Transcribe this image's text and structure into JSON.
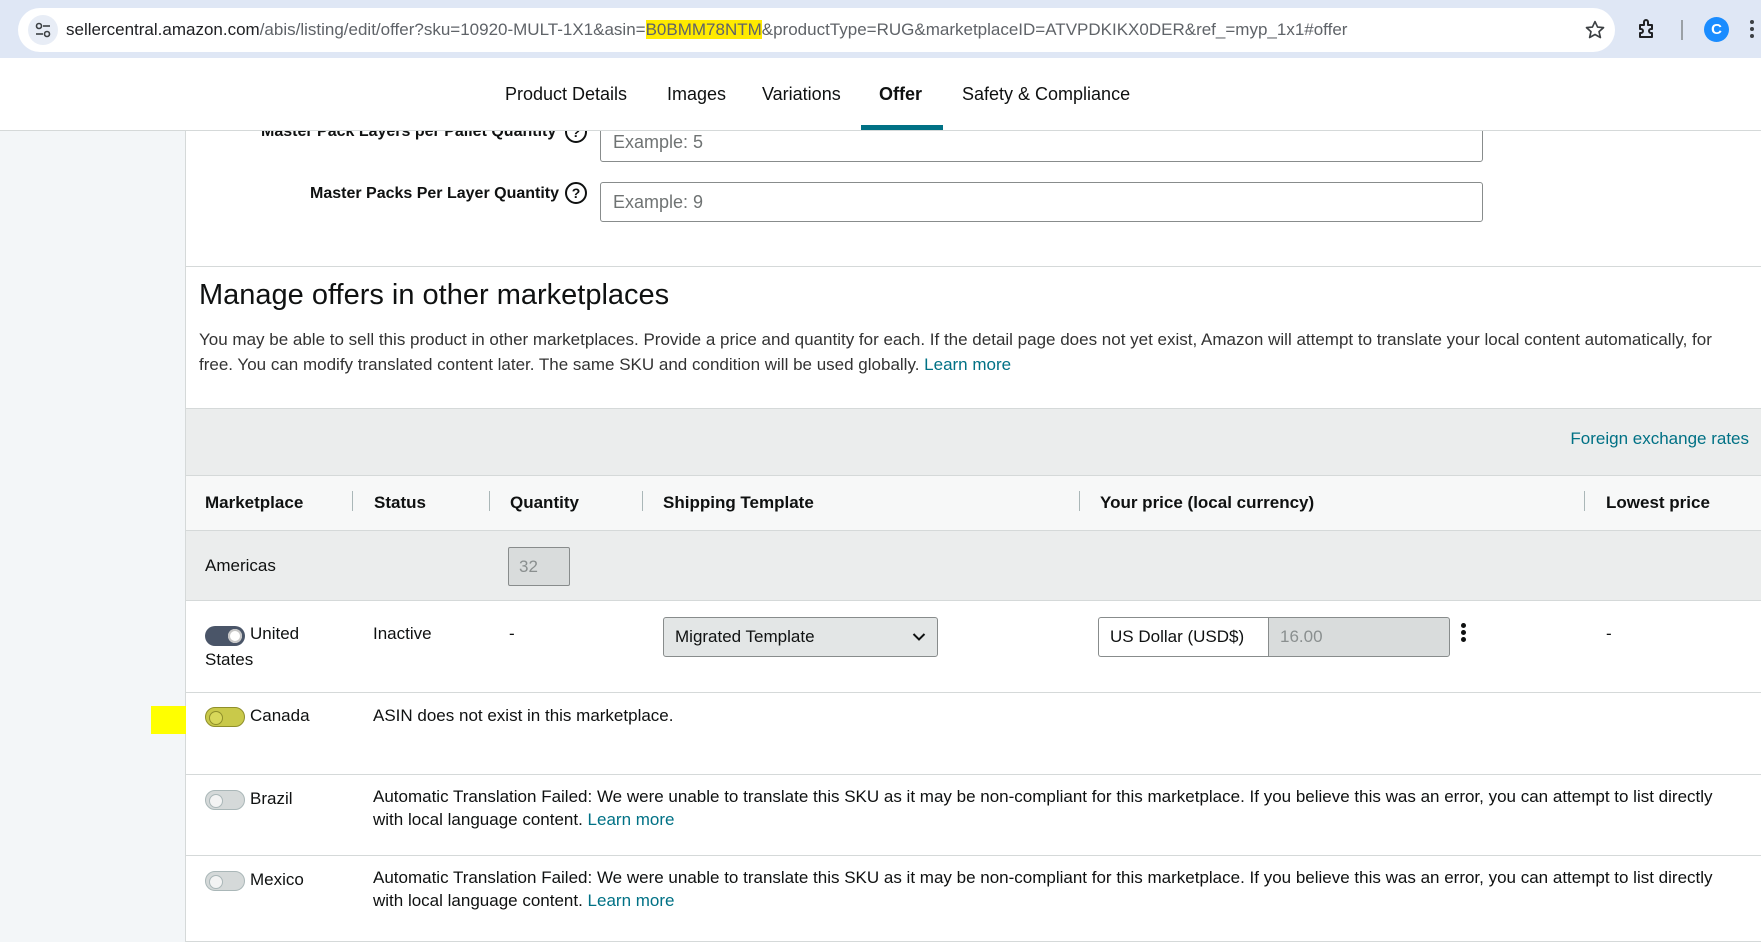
{
  "browser": {
    "url_host": "sellercentral.amazon.com",
    "url_path_before": "/abis/listing/edit/offer?sku=10920-MULT-1X1&asin=",
    "url_highlight": "B0BMM78NTM",
    "url_path_after": "&productType=RUG&marketplaceID=ATVPDKIKX0DER&ref_=myp_1x1#offer",
    "profile_initial": "C"
  },
  "tabs": [
    {
      "label": "Product Details"
    },
    {
      "label": "Images"
    },
    {
      "label": "Variations"
    },
    {
      "label": "Offer",
      "active": true
    },
    {
      "label": "Safety & Compliance"
    }
  ],
  "fields": {
    "layers_label": "Master Pack Layers per Pallet Quantity",
    "layers_placeholder": "Example: 5",
    "packs_label": "Master Packs Per Layer Quantity",
    "packs_placeholder": "Example: 9",
    "help_glyph": "?"
  },
  "section": {
    "title": "Manage offers in other marketplaces",
    "description": "You may be able to sell this product in other marketplaces. Provide a price and quantity for each. If the detail page does not yet exist, Amazon will attempt to translate your local content automatically, for free. You can modify translated content later. The same SKU and condition will be used globally.",
    "learn_more": "Learn more",
    "fx_link": "Foreign exchange rates"
  },
  "table": {
    "headers": {
      "marketplace": "Marketplace",
      "status": "Status",
      "quantity": "Quantity",
      "shipping": "Shipping Template",
      "price": "Your price (local currency)",
      "lowest": "Lowest price"
    },
    "region": {
      "label": "Americas",
      "quantity": "32"
    },
    "us": {
      "marketplace": "United States",
      "status": "Inactive",
      "quantity": "-",
      "shipping": "Migrated Template",
      "currency": "US Dollar (USD$)",
      "price": "16.00",
      "lowest": "-",
      "enabled": true
    },
    "canada": {
      "marketplace": "Canada",
      "status": "ASIN does not exist in this marketplace.",
      "enabled": false,
      "highlighted": true
    },
    "brazil": {
      "marketplace": "Brazil",
      "status": "Automatic Translation Failed: We were unable to translate this SKU as it may be non-compliant for this marketplace. If you believe this was an error, you can attempt to list directly with local language content.",
      "learn_more": "Learn more",
      "enabled": false
    },
    "mexico": {
      "marketplace": "Mexico",
      "status": "Automatic Translation Failed: We were unable to translate this SKU as it may be non-compliant for this marketplace. If you believe this was an error, you can attempt to list directly with local language content.",
      "learn_more": "Learn more",
      "enabled": false
    }
  },
  "colors": {
    "accent_teal": "#007185",
    "highlight_yellow": "#ffff00",
    "url_highlight": "#ffea00",
    "toggle_on": "#4a5568"
  },
  "icons": [
    "tune-icon",
    "star-icon",
    "puzzle-icon",
    "profile-icon",
    "more-vert-icon",
    "help-icon",
    "chevron-down-icon",
    "kebab-icon"
  ]
}
